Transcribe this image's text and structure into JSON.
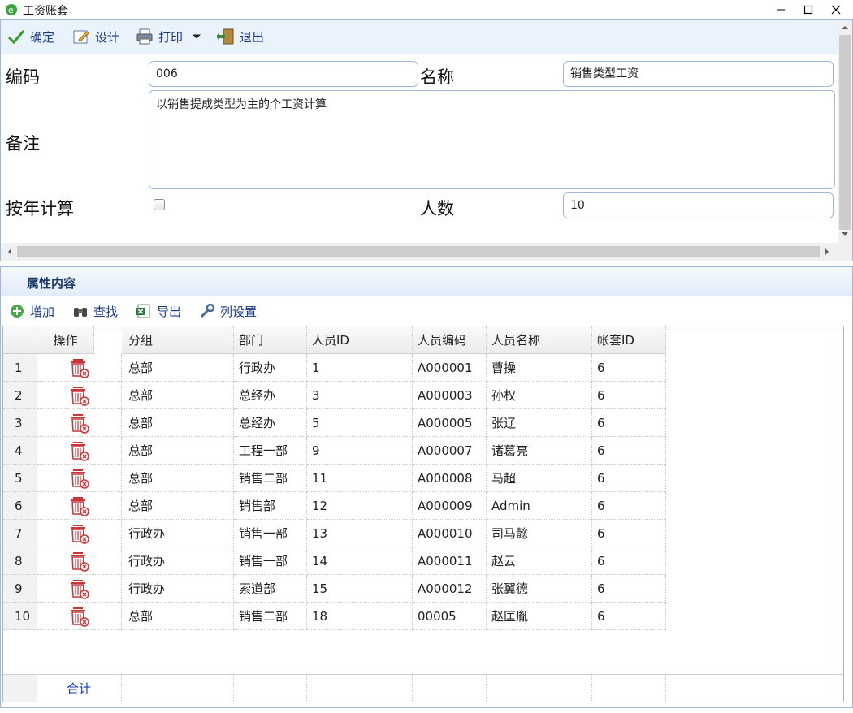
{
  "window": {
    "title": "工资账套"
  },
  "toolbar": {
    "confirm": "确定",
    "design": "设计",
    "print": "打印",
    "exit": "退出"
  },
  "form": {
    "code_label": "编码",
    "code_value": "006",
    "name_label": "名称",
    "name_value": "销售类型工资",
    "remark_label": "备注",
    "remark_value": "以销售提成类型为主的个工资计算",
    "by_year_label": "按年计算",
    "by_year_checked": false,
    "count_label": "人数",
    "count_value": "10"
  },
  "attr_panel": {
    "title": "属性内容",
    "toolbar": {
      "add": "增加",
      "find": "查找",
      "export": "导出",
      "columns": "列设置"
    },
    "columns": [
      "操作",
      "分组",
      "部门",
      "人员ID",
      "人员编码",
      "人员名称",
      "帐套ID"
    ],
    "rows": [
      {
        "num": "1",
        "group": "总部",
        "dept": "行政办",
        "pid": "1",
        "pcode": "A000001",
        "pname": "曹操",
        "aid": "6"
      },
      {
        "num": "2",
        "group": "总部",
        "dept": "总经办",
        "pid": "3",
        "pcode": "A000003",
        "pname": "孙权",
        "aid": "6"
      },
      {
        "num": "3",
        "group": "总部",
        "dept": "总经办",
        "pid": "5",
        "pcode": "A000005",
        "pname": "张辽",
        "aid": "6"
      },
      {
        "num": "4",
        "group": "总部",
        "dept": "工程一部",
        "pid": "9",
        "pcode": "A000007",
        "pname": "诸葛亮",
        "aid": "6"
      },
      {
        "num": "5",
        "group": "总部",
        "dept": "销售二部",
        "pid": "11",
        "pcode": "A000008",
        "pname": "马超",
        "aid": "6"
      },
      {
        "num": "6",
        "group": "总部",
        "dept": "销售部",
        "pid": "12",
        "pcode": "A000009",
        "pname": "Admin",
        "aid": "6"
      },
      {
        "num": "7",
        "group": "行政办",
        "dept": "销售一部",
        "pid": "13",
        "pcode": "A000010",
        "pname": "司马懿",
        "aid": "6"
      },
      {
        "num": "8",
        "group": "行政办",
        "dept": "销售一部",
        "pid": "14",
        "pcode": "A000011",
        "pname": "赵云",
        "aid": "6"
      },
      {
        "num": "9",
        "group": "行政办",
        "dept": "索道部",
        "pid": "15",
        "pcode": "A000012",
        "pname": "张翼德",
        "aid": "6"
      },
      {
        "num": "10",
        "group": "总部",
        "dept": "销售二部",
        "pid": "18",
        "pcode": "00005",
        "pname": "赵匡胤",
        "aid": "6"
      }
    ],
    "footer_total": "合计"
  },
  "colors": {
    "toolbar_bg": "#eaf2fc",
    "border": "#9fb7d9",
    "link": "#1a3a8a",
    "delete_icon": "#d33a3a"
  }
}
